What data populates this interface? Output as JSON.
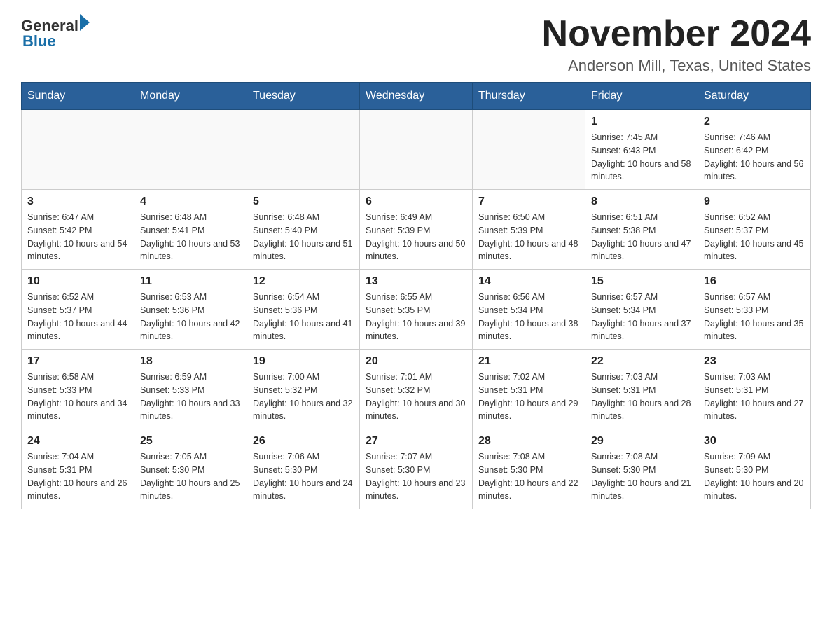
{
  "logo": {
    "text_general": "General",
    "text_blue": "Blue"
  },
  "title": "November 2024",
  "subtitle": "Anderson Mill, Texas, United States",
  "days_of_week": [
    "Sunday",
    "Monday",
    "Tuesday",
    "Wednesday",
    "Thursday",
    "Friday",
    "Saturday"
  ],
  "weeks": [
    [
      {
        "day": "",
        "info": ""
      },
      {
        "day": "",
        "info": ""
      },
      {
        "day": "",
        "info": ""
      },
      {
        "day": "",
        "info": ""
      },
      {
        "day": "",
        "info": ""
      },
      {
        "day": "1",
        "info": "Sunrise: 7:45 AM\nSunset: 6:43 PM\nDaylight: 10 hours and 58 minutes."
      },
      {
        "day": "2",
        "info": "Sunrise: 7:46 AM\nSunset: 6:42 PM\nDaylight: 10 hours and 56 minutes."
      }
    ],
    [
      {
        "day": "3",
        "info": "Sunrise: 6:47 AM\nSunset: 5:42 PM\nDaylight: 10 hours and 54 minutes."
      },
      {
        "day": "4",
        "info": "Sunrise: 6:48 AM\nSunset: 5:41 PM\nDaylight: 10 hours and 53 minutes."
      },
      {
        "day": "5",
        "info": "Sunrise: 6:48 AM\nSunset: 5:40 PM\nDaylight: 10 hours and 51 minutes."
      },
      {
        "day": "6",
        "info": "Sunrise: 6:49 AM\nSunset: 5:39 PM\nDaylight: 10 hours and 50 minutes."
      },
      {
        "day": "7",
        "info": "Sunrise: 6:50 AM\nSunset: 5:39 PM\nDaylight: 10 hours and 48 minutes."
      },
      {
        "day": "8",
        "info": "Sunrise: 6:51 AM\nSunset: 5:38 PM\nDaylight: 10 hours and 47 minutes."
      },
      {
        "day": "9",
        "info": "Sunrise: 6:52 AM\nSunset: 5:37 PM\nDaylight: 10 hours and 45 minutes."
      }
    ],
    [
      {
        "day": "10",
        "info": "Sunrise: 6:52 AM\nSunset: 5:37 PM\nDaylight: 10 hours and 44 minutes."
      },
      {
        "day": "11",
        "info": "Sunrise: 6:53 AM\nSunset: 5:36 PM\nDaylight: 10 hours and 42 minutes."
      },
      {
        "day": "12",
        "info": "Sunrise: 6:54 AM\nSunset: 5:36 PM\nDaylight: 10 hours and 41 minutes."
      },
      {
        "day": "13",
        "info": "Sunrise: 6:55 AM\nSunset: 5:35 PM\nDaylight: 10 hours and 39 minutes."
      },
      {
        "day": "14",
        "info": "Sunrise: 6:56 AM\nSunset: 5:34 PM\nDaylight: 10 hours and 38 minutes."
      },
      {
        "day": "15",
        "info": "Sunrise: 6:57 AM\nSunset: 5:34 PM\nDaylight: 10 hours and 37 minutes."
      },
      {
        "day": "16",
        "info": "Sunrise: 6:57 AM\nSunset: 5:33 PM\nDaylight: 10 hours and 35 minutes."
      }
    ],
    [
      {
        "day": "17",
        "info": "Sunrise: 6:58 AM\nSunset: 5:33 PM\nDaylight: 10 hours and 34 minutes."
      },
      {
        "day": "18",
        "info": "Sunrise: 6:59 AM\nSunset: 5:33 PM\nDaylight: 10 hours and 33 minutes."
      },
      {
        "day": "19",
        "info": "Sunrise: 7:00 AM\nSunset: 5:32 PM\nDaylight: 10 hours and 32 minutes."
      },
      {
        "day": "20",
        "info": "Sunrise: 7:01 AM\nSunset: 5:32 PM\nDaylight: 10 hours and 30 minutes."
      },
      {
        "day": "21",
        "info": "Sunrise: 7:02 AM\nSunset: 5:31 PM\nDaylight: 10 hours and 29 minutes."
      },
      {
        "day": "22",
        "info": "Sunrise: 7:03 AM\nSunset: 5:31 PM\nDaylight: 10 hours and 28 minutes."
      },
      {
        "day": "23",
        "info": "Sunrise: 7:03 AM\nSunset: 5:31 PM\nDaylight: 10 hours and 27 minutes."
      }
    ],
    [
      {
        "day": "24",
        "info": "Sunrise: 7:04 AM\nSunset: 5:31 PM\nDaylight: 10 hours and 26 minutes."
      },
      {
        "day": "25",
        "info": "Sunrise: 7:05 AM\nSunset: 5:30 PM\nDaylight: 10 hours and 25 minutes."
      },
      {
        "day": "26",
        "info": "Sunrise: 7:06 AM\nSunset: 5:30 PM\nDaylight: 10 hours and 24 minutes."
      },
      {
        "day": "27",
        "info": "Sunrise: 7:07 AM\nSunset: 5:30 PM\nDaylight: 10 hours and 23 minutes."
      },
      {
        "day": "28",
        "info": "Sunrise: 7:08 AM\nSunset: 5:30 PM\nDaylight: 10 hours and 22 minutes."
      },
      {
        "day": "29",
        "info": "Sunrise: 7:08 AM\nSunset: 5:30 PM\nDaylight: 10 hours and 21 minutes."
      },
      {
        "day": "30",
        "info": "Sunrise: 7:09 AM\nSunset: 5:30 PM\nDaylight: 10 hours and 20 minutes."
      }
    ]
  ]
}
